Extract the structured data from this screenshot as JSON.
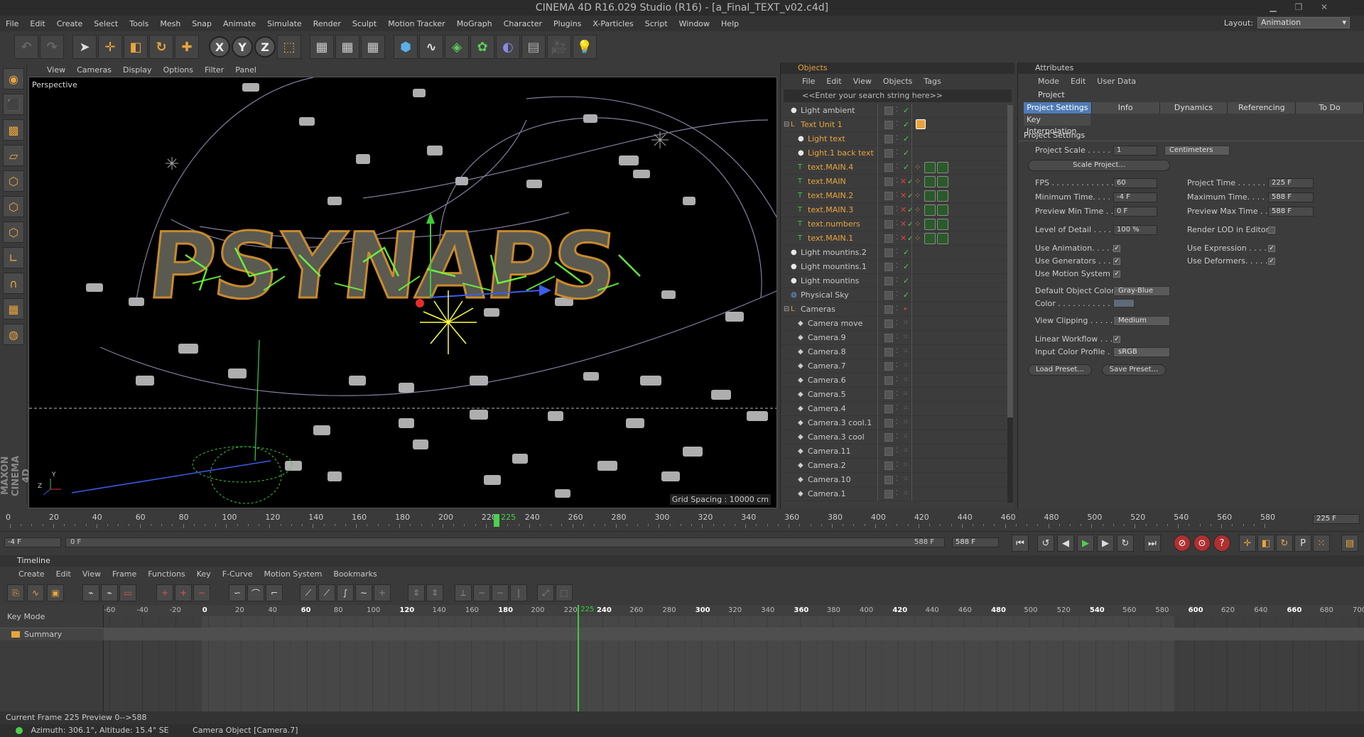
{
  "window": {
    "title": "CINEMA 4D R16.029 Studio (R16) - [a_Final_TEXT_v02.c4d]"
  },
  "menu": [
    "File",
    "Edit",
    "Create",
    "Select",
    "Tools",
    "Mesh",
    "Snap",
    "Animate",
    "Simulate",
    "Render",
    "Sculpt",
    "Motion Tracker",
    "MoGraph",
    "Character",
    "Plugins",
    "X-Particles",
    "Script",
    "Window",
    "Help"
  ],
  "layout": {
    "label": "Layout:",
    "value": "Animation"
  },
  "viewport": {
    "menu": [
      "View",
      "Cameras",
      "Display",
      "Options",
      "Filter",
      "Panel"
    ],
    "label": "Perspective",
    "grid_spacing": "Grid Spacing : 10000 cm",
    "scene_text": "PSYNAPS"
  },
  "brand": "MAXON CINEMA 4D",
  "objects": {
    "title": "Objects",
    "menu": [
      "File",
      "Edit",
      "View",
      "Objects",
      "Tags"
    ],
    "search_placeholder": "<<Enter your search string here>>",
    "rows": [
      {
        "name": "Light ambient",
        "color": "#c8c8c8",
        "indent": 0,
        "type": "light",
        "vis": "tick"
      },
      {
        "name": "Text Unit 1",
        "color": "#e8a43c",
        "indent": 0,
        "type": "null",
        "vis": "tick",
        "tag": "display"
      },
      {
        "name": "Light text",
        "color": "#e8a43c",
        "indent": 1,
        "type": "light",
        "vis": "tick"
      },
      {
        "name": "Light.1 back text",
        "color": "#e8a43c",
        "indent": 1,
        "type": "light",
        "vis": "tick"
      },
      {
        "name": "text.MAIN.4",
        "color": "#e8a43c",
        "indent": 1,
        "type": "text",
        "vis": "tick",
        "tag": "mat"
      },
      {
        "name": "text.MAIN",
        "color": "#e8a43c",
        "indent": 1,
        "type": "text",
        "vis": "x",
        "tag": "mat"
      },
      {
        "name": "text.MAIN.2",
        "color": "#e8a43c",
        "indent": 1,
        "type": "text",
        "vis": "x",
        "tag": "mat"
      },
      {
        "name": "text.MAIN.3",
        "color": "#e8a43c",
        "indent": 1,
        "type": "text",
        "vis": "x",
        "tag": "mat"
      },
      {
        "name": "text.numbers",
        "color": "#e8a43c",
        "indent": 1,
        "type": "text",
        "vis": "x",
        "tag": "mat"
      },
      {
        "name": "text.MAIN.1",
        "color": "#e8a43c",
        "indent": 1,
        "type": "text",
        "vis": "x",
        "tag": "mat"
      },
      {
        "name": "Light mountins.2",
        "color": "#c8c8c8",
        "indent": 0,
        "type": "light",
        "vis": "tick"
      },
      {
        "name": "Light mountins.1",
        "color": "#c8c8c8",
        "indent": 0,
        "type": "light",
        "vis": "tick"
      },
      {
        "name": "Light mountins",
        "color": "#c8c8c8",
        "indent": 0,
        "type": "light",
        "vis": "tick"
      },
      {
        "name": "Physical Sky",
        "color": "#c8c8c8",
        "indent": 0,
        "type": "sky",
        "vis": "tick"
      },
      {
        "name": "Cameras",
        "color": "#c8c8c8",
        "indent": 0,
        "type": "null",
        "vis": "red"
      },
      {
        "name": "Camera move",
        "color": "#c8c8c8",
        "indent": 1,
        "type": "camera",
        "vis": "none"
      },
      {
        "name": "Camera.9",
        "color": "#c8c8c8",
        "indent": 1,
        "type": "camera",
        "vis": "none"
      },
      {
        "name": "Camera.8",
        "color": "#c8c8c8",
        "indent": 1,
        "type": "camera",
        "vis": "none"
      },
      {
        "name": "Camera.7",
        "color": "#c8c8c8",
        "indent": 1,
        "type": "camera",
        "vis": "none"
      },
      {
        "name": "Camera.6",
        "color": "#c8c8c8",
        "indent": 1,
        "type": "camera",
        "vis": "none"
      },
      {
        "name": "Camera.5",
        "color": "#c8c8c8",
        "indent": 1,
        "type": "camera",
        "vis": "none"
      },
      {
        "name": "Camera.4",
        "color": "#c8c8c8",
        "indent": 1,
        "type": "camera",
        "vis": "none"
      },
      {
        "name": "Camera.3 cool.1",
        "color": "#c8c8c8",
        "indent": 1,
        "type": "camera",
        "vis": "none"
      },
      {
        "name": "Camera.3 cool",
        "color": "#c8c8c8",
        "indent": 1,
        "type": "camera",
        "vis": "none"
      },
      {
        "name": "Camera.11",
        "color": "#c8c8c8",
        "indent": 1,
        "type": "camera",
        "vis": "none"
      },
      {
        "name": "Camera.2",
        "color": "#c8c8c8",
        "indent": 1,
        "type": "camera",
        "vis": "none"
      },
      {
        "name": "Camera.10",
        "color": "#c8c8c8",
        "indent": 1,
        "type": "camera",
        "vis": "none"
      },
      {
        "name": "Camera.1",
        "color": "#c8c8c8",
        "indent": 1,
        "type": "camera",
        "vis": "none"
      }
    ]
  },
  "attributes": {
    "title": "Attributes",
    "menu": [
      "Mode",
      "Edit",
      "User Data"
    ],
    "object": "Project",
    "tabs": [
      "Project Settings",
      "Info",
      "Dynamics",
      "Referencing",
      "To Do"
    ],
    "active_tab": "Project Settings",
    "subtab": "Key Interpolation",
    "section": "Project Settings",
    "project_scale": {
      "label": "Project Scale . . . . . .",
      "value": "1",
      "unit": "Centimeters"
    },
    "scale_button": "Scale Project...",
    "fps": {
      "label": "FPS . . . . . . . . . . . . . .",
      "value": "60"
    },
    "project_time": {
      "label": "Project Time . . . . . . .",
      "value": "225 F"
    },
    "min_time": {
      "label": "Minimum Time. . . . . . .",
      "value": "-4 F"
    },
    "max_time": {
      "label": "Maximum Time. . . . . . .",
      "value": "588 F"
    },
    "preview_min": {
      "label": "Preview Min Time . . .",
      "value": "0 F"
    },
    "preview_max": {
      "label": "Preview Max Time . . .",
      "value": "588 F"
    },
    "lod": {
      "label": "Level of Detail . . . . .",
      "value": "100 %"
    },
    "render_lod": "Render LOD in Editor",
    "use_animation": "Use Animation. . . . .",
    "use_expression": "Use Expression . . . . .",
    "use_generators": "Use Generators . . . .",
    "use_deformers": "Use Deformers. . . . .",
    "use_motion": "Use Motion System",
    "default_color": {
      "label": "Default Object Color",
      "value": "Gray-Blue"
    },
    "color_label": "Color . . . . . . . . . . .",
    "view_clipping": {
      "label": "View Clipping . . . . .",
      "value": "Medium"
    },
    "linear_workflow": "Linear Workflow . . . .",
    "input_profile": {
      "label": "Input Color Profile .",
      "value": "sRGB"
    },
    "load_preset": "Load Preset...",
    "save_preset": "Save Preset..."
  },
  "ruler": {
    "ticks": [
      "0",
      "20",
      "40",
      "60",
      "80",
      "100",
      "120",
      "140",
      "160",
      "180",
      "200",
      "220",
      "240",
      "260",
      "280",
      "300",
      "320",
      "340",
      "360",
      "380",
      "400",
      "420",
      "440",
      "460",
      "480",
      "500",
      "520",
      "540",
      "560",
      "580"
    ],
    "current": "225",
    "end_field": "225 F"
  },
  "controls": {
    "start": "-4 F",
    "range_start": "0 F",
    "range_end": "588 F",
    "end": "588 F"
  },
  "timeline": {
    "title": "Timeline",
    "menu": [
      "Create",
      "Edit",
      "View",
      "Frame",
      "Functions",
      "Key",
      "F-Curve",
      "Motion System",
      "Bookmarks"
    ],
    "key_mode": "Key Mode",
    "summary": "Summary",
    "ticks": [
      "-60",
      "-40",
      "-20",
      "0",
      "20",
      "40",
      "60",
      "80",
      "100",
      "120",
      "140",
      "160",
      "180",
      "200",
      "220",
      "240",
      "260",
      "280",
      "300",
      "320",
      "340",
      "360",
      "380",
      "400",
      "420",
      "440",
      "460",
      "480",
      "500",
      "520",
      "540",
      "560",
      "580",
      "600",
      "620",
      "640",
      "660",
      "680",
      "700"
    ],
    "bold_ticks": [
      "0",
      "60",
      "120",
      "180",
      "240",
      "300",
      "360",
      "420",
      "480",
      "540",
      "600",
      "660"
    ],
    "current": "225"
  },
  "status": {
    "frame": "Current Frame  225  Preview  0-->588",
    "azimuth": "Azimuth: 306.1°, Altitude: 15.4°  SE",
    "object": "Camera Object [Camera.7]"
  },
  "colors": {
    "accent": "#e8a43c",
    "active_tab": "#4f7bb5",
    "frame_marker": "#4cd04c"
  }
}
